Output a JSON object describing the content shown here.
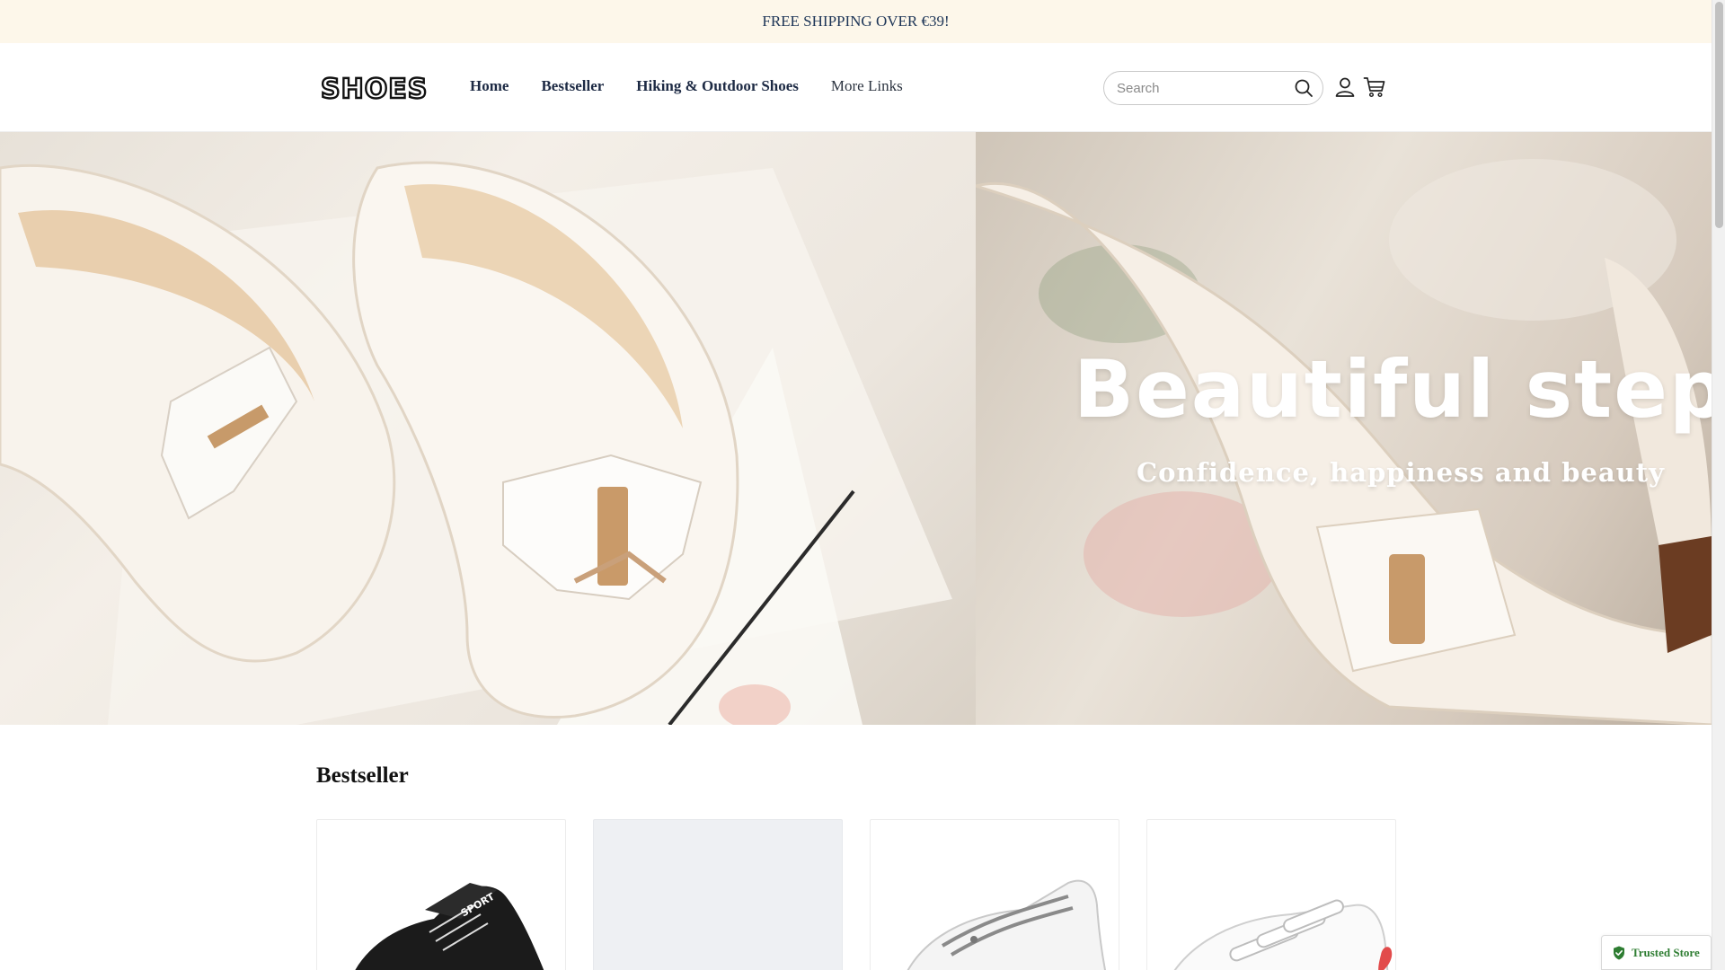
{
  "announcement": {
    "text": "FREE SHIPPING OVER €39!"
  },
  "header": {
    "logo_text": "SHOES",
    "nav": [
      {
        "label": "Home"
      },
      {
        "label": "Bestseller"
      },
      {
        "label": "Hiking & Outdoor Shoes"
      },
      {
        "label": "More Links"
      }
    ],
    "search": {
      "placeholder": "Search",
      "value": ""
    },
    "icons": {
      "account": "user-icon",
      "cart": "cart-icon",
      "search": "search-icon"
    }
  },
  "hero": {
    "title": "Beautiful step",
    "subtitle": "Confidence, happiness and beauty"
  },
  "bestseller": {
    "title": "Bestseller",
    "products": [
      {
        "image": "black-sneaker",
        "image_text": "SPORT"
      },
      {
        "image": "placeholder"
      },
      {
        "image": "white-sneaker-grey-laces"
      },
      {
        "image": "white-velcro-sneaker-heart"
      }
    ]
  },
  "trusted_badge": {
    "label": "Trusted Store",
    "color": "#2e7d32"
  },
  "colors": {
    "announcement_bg": "#fdf7ea",
    "nav_text": "#1d2a44",
    "hero_text": "#ffffff"
  }
}
